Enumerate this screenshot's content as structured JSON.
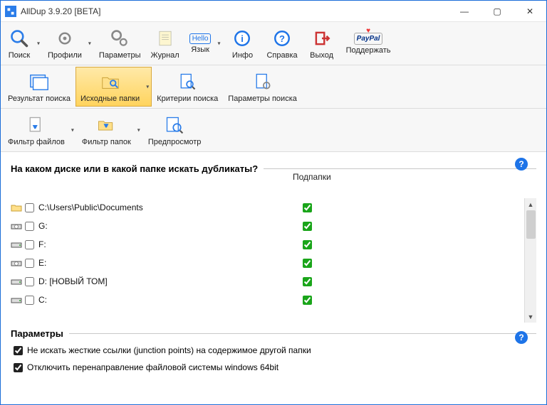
{
  "window": {
    "title": "AllDup 3.9.20 [BETA]"
  },
  "toolbar1": {
    "search": "Поиск",
    "profiles": "Профили",
    "settings": "Параметры",
    "log": "Журнал",
    "language": "Язык",
    "language_hello": "Hello",
    "info": "Инфо",
    "help": "Справка",
    "exit": "Выход",
    "donate": "Поддержать",
    "donate_brand": "PayPal"
  },
  "toolbar2": {
    "results": "Результат поиска",
    "source": "Исходные папки",
    "criteria": "Критерии поиска",
    "searchparams": "Параметры поиска"
  },
  "toolbar3": {
    "filefilter": "Фильтр файлов",
    "folderfilter": "Фильтр папок",
    "preview": "Предпросмотр"
  },
  "main": {
    "question": "На каком диске или в какой папке искать дубликаты?",
    "subfolder_header": "Подпапки",
    "drives": [
      {
        "label": "C:",
        "icon": "drive-hdd"
      },
      {
        "label": "D: [НОВЫЙ ТОМ]",
        "icon": "drive-hdd"
      },
      {
        "label": "E:",
        "icon": "drive-cd"
      },
      {
        "label": "F:",
        "icon": "drive-hdd"
      },
      {
        "label": "G:",
        "icon": "drive-cd"
      },
      {
        "label": "C:\\Users\\Public\\Documents",
        "icon": "folder"
      }
    ]
  },
  "params": {
    "title": "Параметры",
    "opt1": "Не искать жесткие ссылки (junction points) на содержимое другой папки",
    "opt2": "Отключить перенаправление файловой системы windows 64bit"
  },
  "glyphs": {
    "help": "?",
    "dropdown": "▾",
    "min": "—",
    "max": "▢",
    "close": "✕",
    "up": "▲",
    "down": "▼"
  }
}
